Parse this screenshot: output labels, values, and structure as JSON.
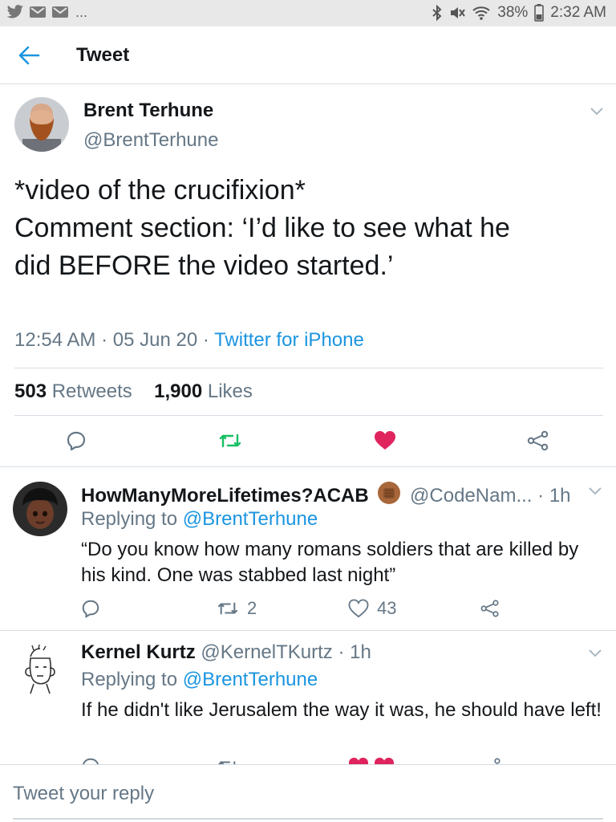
{
  "status_bar": {
    "battery": "38%",
    "time": "2:32 AM",
    "overflow": "..."
  },
  "header": {
    "title": "Tweet"
  },
  "main_tweet": {
    "name": "Brent Terhune",
    "handle": "@BrentTerhune",
    "text_lines": [
      "*video of the crucifixion*",
      "",
      "Comment section: ‘I’d like to see what he",
      "did BEFORE the video started.’"
    ],
    "time": "12:54 AM",
    "date": "05 Jun 20",
    "source": "Twitter for iPhone",
    "retweets_count": "503",
    "retweets_label": "Retweets",
    "likes_count": "1,900",
    "likes_label": "Likes",
    "liked": true
  },
  "replies": [
    {
      "name": "HowManyMoreLifetimes?ACAB",
      "handle": "@CodeNam...",
      "age": "1h",
      "replying_prefix": "Replying to",
      "replying_to": "@BrentTerhune",
      "text": "“Do you know how many romans soldiers that are killed by his kind. One was stabbed last night”",
      "retweet_count": "2",
      "like_count": "43"
    },
    {
      "name": "Kernel Kurtz",
      "handle": "@KernelTKurtz",
      "age": "1h",
      "replying_prefix": "Replying to",
      "replying_to": "@BrentTerhune",
      "text": "If he didn't like Jerusalem the way it was, he should have left!"
    }
  ],
  "reply_bar": {
    "placeholder": "Tweet your reply"
  },
  "colors": {
    "accent": "#1b95e0",
    "retweet_green": "#17bf63",
    "like_red": "#e0245e",
    "muted": "#657786",
    "divider": "#d6dde3"
  }
}
